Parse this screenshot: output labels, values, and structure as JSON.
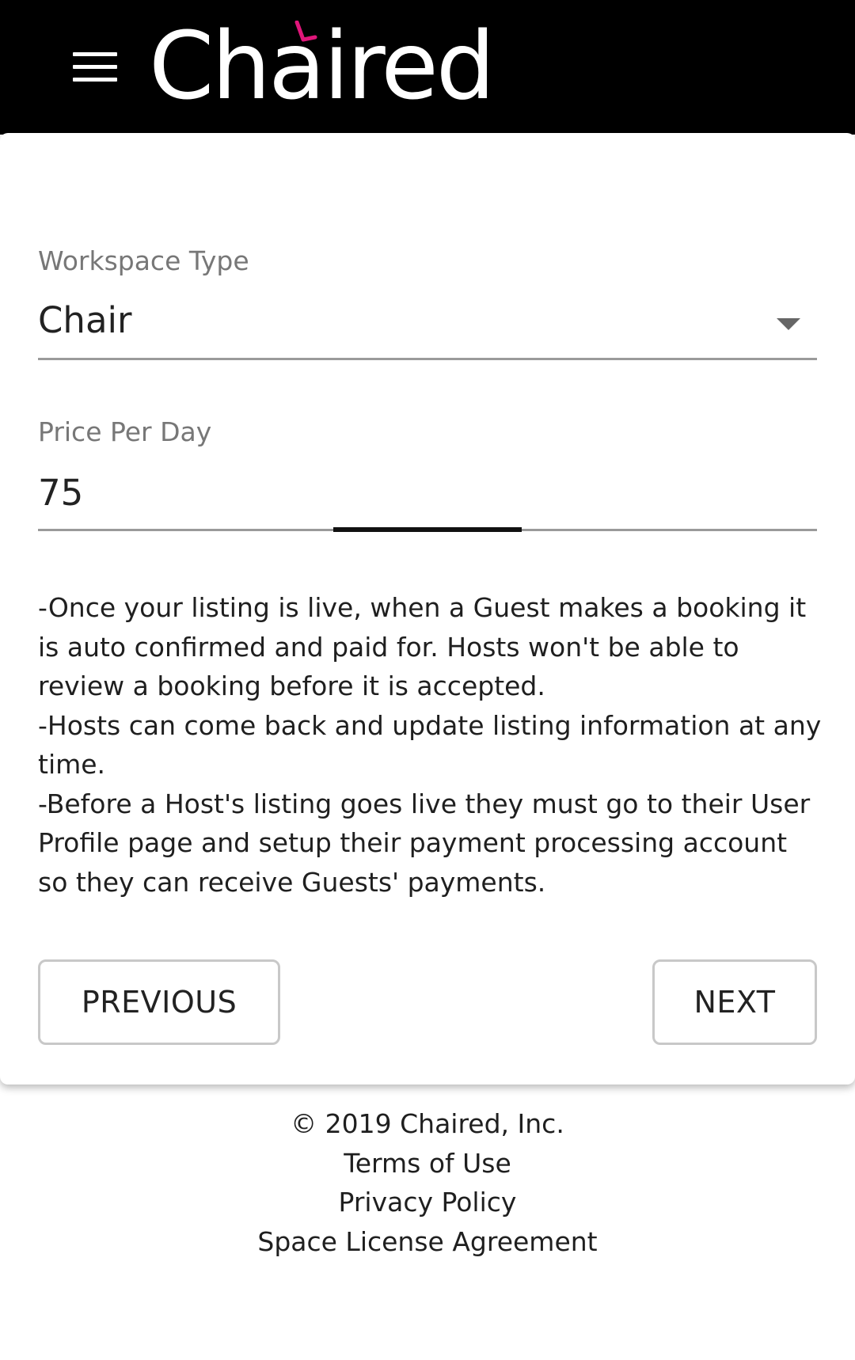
{
  "header": {
    "menu_icon": "hamburger-menu-icon",
    "logo_text": "Chaired",
    "logo_accent_color": "#e0167a",
    "background_color": "#000000"
  },
  "form": {
    "workspace_type": {
      "label": "Workspace Type",
      "selected_value": "Chair",
      "icon": "caret-down-icon"
    },
    "price_per_day": {
      "label": "Price Per Day",
      "value": "75"
    },
    "info_lines": [
      "-Once your listing is live, when a Guest makes a booking it is auto confirmed and paid for. Hosts won't be able to review a booking before it is accepted.",
      "-Hosts can come back and update listing information at any time.",
      "-Before a Host's listing goes live they must go to their User Profile page and setup their payment processing account so they can receive Guests' payments."
    ],
    "previous_label": "PREVIOUS",
    "next_label": "NEXT"
  },
  "footer": {
    "copyright": "© 2019 Chaired, Inc.",
    "links": [
      "Terms of Use",
      "Privacy Policy",
      "Space License Agreement"
    ]
  }
}
